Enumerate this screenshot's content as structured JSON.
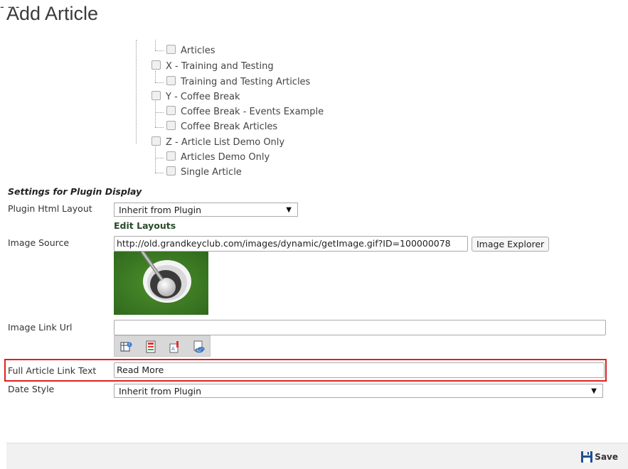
{
  "page": {
    "title": "Add Article"
  },
  "tree": {
    "items": [
      {
        "label": "Articles"
      },
      {
        "label": "X - Training and Testing"
      },
      {
        "label": "Training and Testing Articles"
      },
      {
        "label": "Y - Coffee Break"
      },
      {
        "label": "Coffee Break - Events Example"
      },
      {
        "label": "Coffee Break Articles"
      },
      {
        "label": "Z - Article List Demo Only"
      },
      {
        "label": "Articles Demo Only"
      },
      {
        "label": "Single Article"
      }
    ],
    "expander_symbol": "-"
  },
  "settings": {
    "heading": "Settings for Plugin Display",
    "plugin_html_layout": {
      "label": "Plugin Html Layout",
      "value": "Inherit from Plugin",
      "arrow": "▼"
    },
    "edit_layouts_link": "Edit Layouts",
    "image_source": {
      "label": "Image Source",
      "value": "http://old.grandkeyclub.com/images/dynamic/getImage.gif?ID=100000078",
      "button": "Image Explorer"
    },
    "image_link_url": {
      "label": "Image Link Url",
      "value": ""
    },
    "toolbar_icons": [
      "link-page-icon",
      "link-form-icon",
      "link-document-icon",
      "link-url-icon"
    ],
    "full_article_link_text": {
      "label": "Full Article Link Text",
      "value": "Read More"
    },
    "date_style": {
      "label": "Date Style",
      "value": "Inherit from Plugin",
      "arrow": "▼"
    }
  },
  "footer": {
    "save_label": "Save"
  },
  "colors": {
    "highlight": "#e02020",
    "link": "#2a4a2a",
    "save_icon": "#1f4f8f"
  }
}
